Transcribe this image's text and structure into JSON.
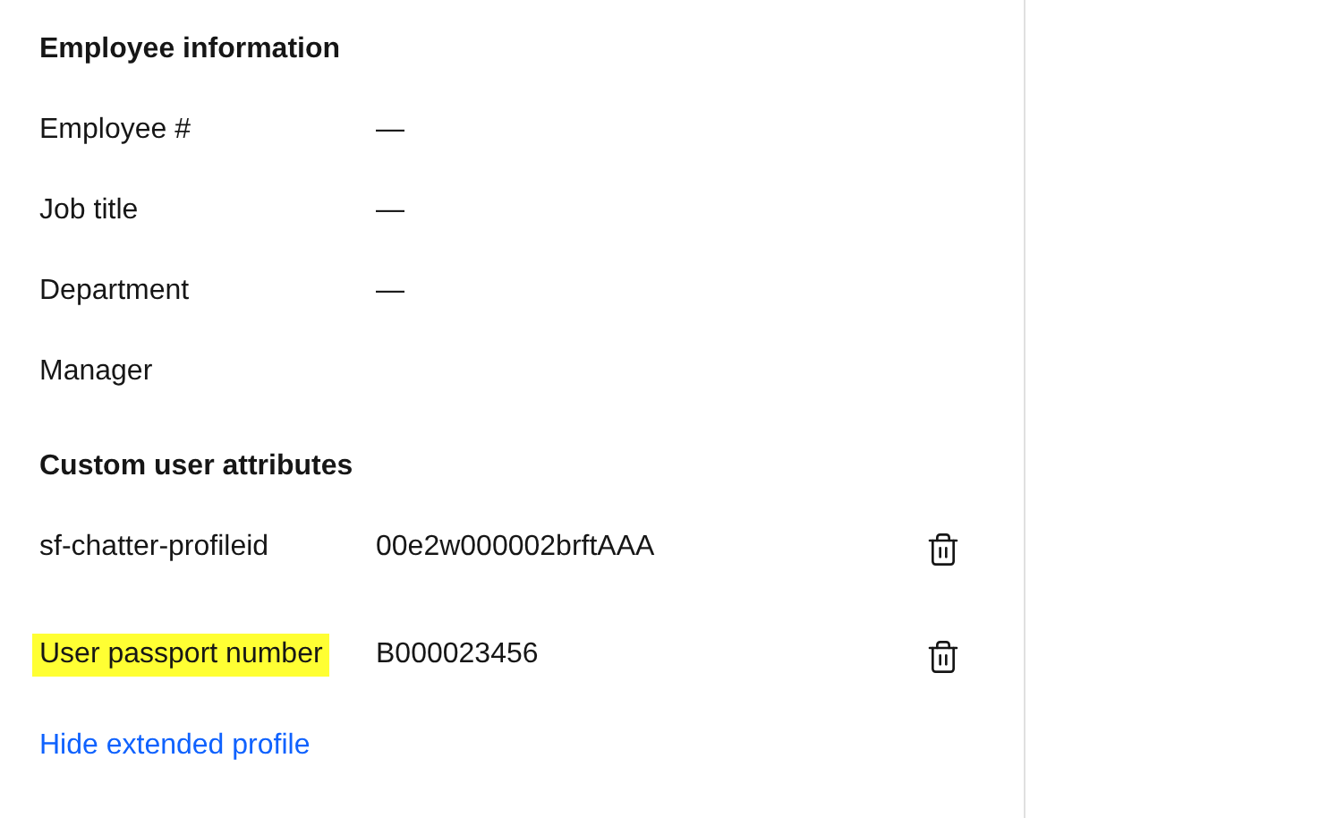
{
  "employee_information": {
    "title": "Employee information",
    "fields": [
      {
        "label": "Employee #",
        "value": "—"
      },
      {
        "label": "Job title",
        "value": "—"
      },
      {
        "label": "Department",
        "value": "—"
      },
      {
        "label": "Manager"
      }
    ]
  },
  "custom_user_attributes": {
    "title": "Custom user attributes",
    "attributes": [
      {
        "name": "sf-chatter-profileid",
        "value": "00e2w000002brftAAA",
        "highlighted": false
      },
      {
        "name": "User passport number",
        "value": "B000023456",
        "highlighted": true
      }
    ]
  },
  "link": "Hide extended profile"
}
